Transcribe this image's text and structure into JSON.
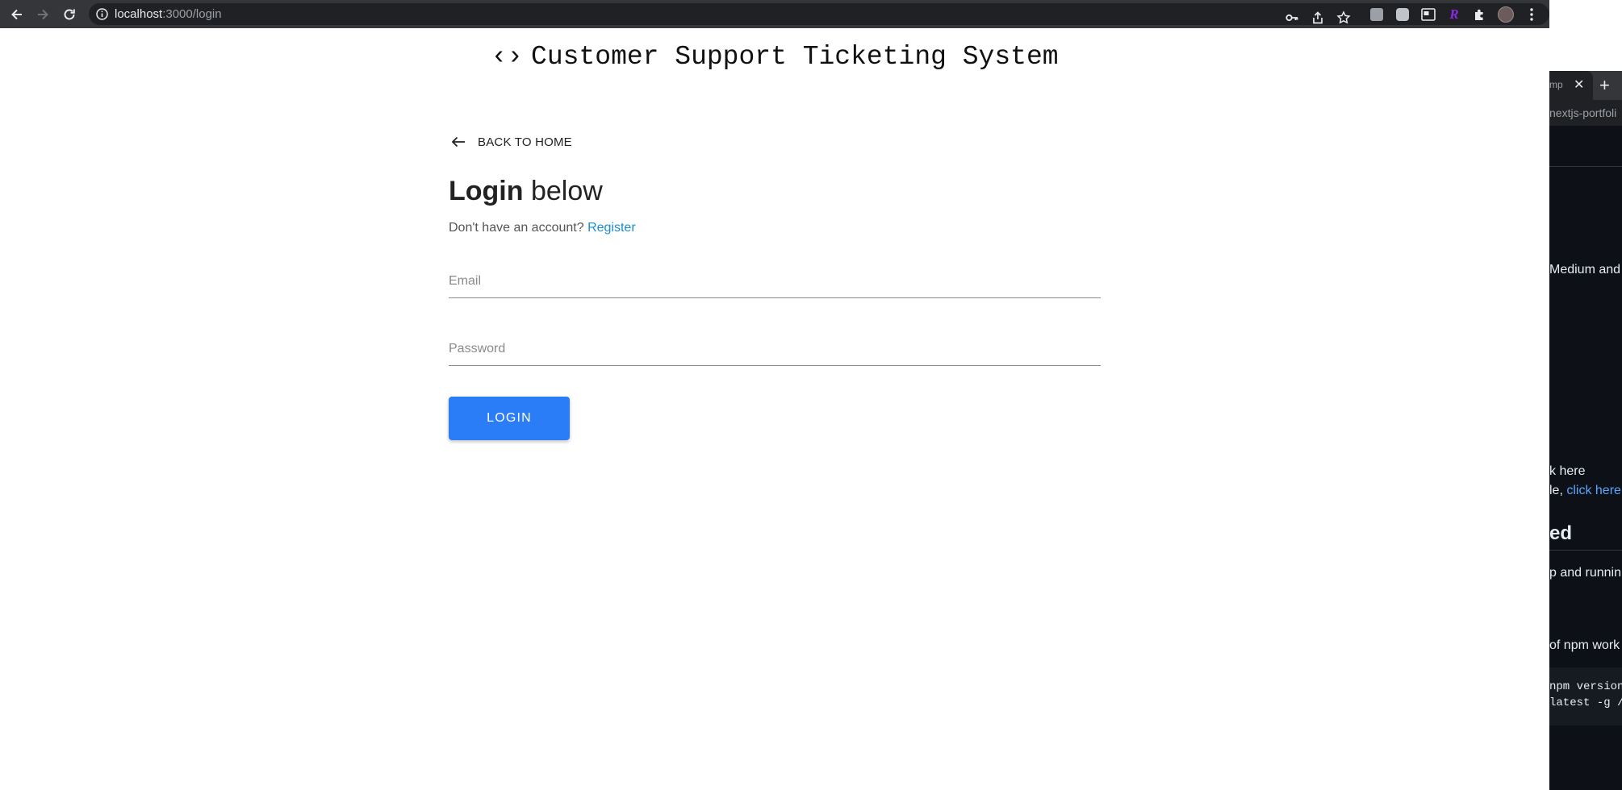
{
  "browser": {
    "url_host": "localhost",
    "url_path": ":3000/login"
  },
  "page": {
    "app_title": "Customer Support Ticketing System",
    "app_icon": "code-brackets-icon",
    "back_link": "BACK TO HOME",
    "heading_bold": "Login",
    "heading_rest": " below",
    "no_account_text": "Don't have an account? ",
    "register_link": "Register",
    "email_placeholder": "Email",
    "password_placeholder": "Password",
    "login_button": "LOGIN",
    "colors": {
      "primary_button": "#2a7df7",
      "link": "#1a8ccf"
    }
  },
  "background_window": {
    "tab_text": "mp",
    "url_text": "nextjs-portfoli",
    "lines": [
      "Medium and",
      "k here",
      "le, ",
      "click here",
      "ed",
      "p and runnin",
      " of npm work"
    ],
    "code_lines": "npm version\nlatest -g /."
  }
}
